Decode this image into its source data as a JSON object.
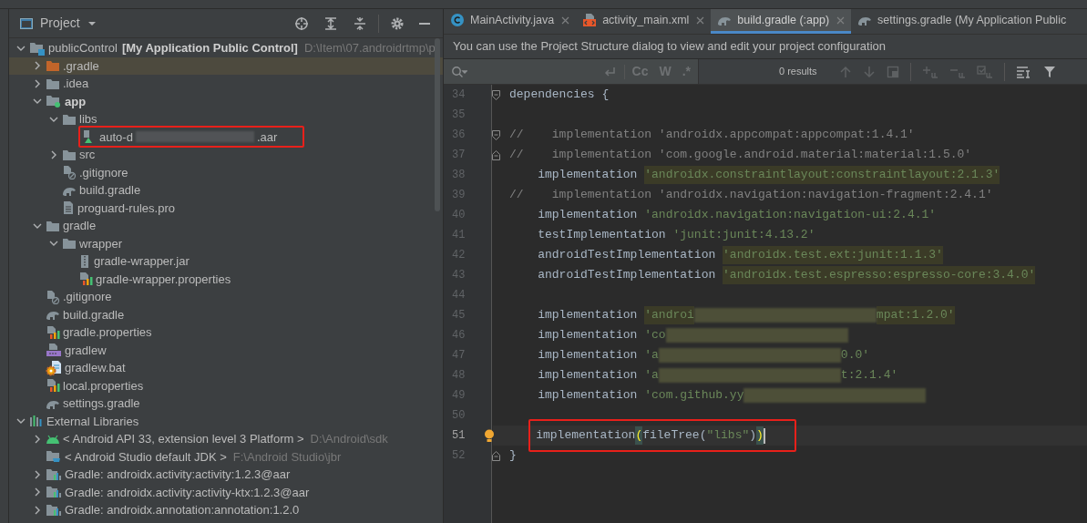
{
  "project_panel": {
    "title": "Project",
    "tree": [
      {
        "name": "publicControl",
        "module": "[My Application Public Control]",
        "path": "D:\\Item\\07.androidrtmp\\p",
        "kind": "module",
        "expanded": true,
        "selected": false,
        "children": [
          {
            "name": ".gradle",
            "kind": "folder-orange",
            "expanded": false,
            "selected": true
          },
          {
            "name": ".idea",
            "kind": "folder",
            "expanded": false,
            "selected": false
          },
          {
            "name": "app",
            "kind": "module-app",
            "expanded": true,
            "selected": false,
            "bold": true,
            "children": [
              {
                "name": "libs",
                "kind": "folder",
                "expanded": true,
                "selected": false,
                "children": [
                  {
                    "name": "auto-d",
                    "suffix": ".aar",
                    "redacted": true,
                    "kind": "aar",
                    "selected": false,
                    "annotated": true
                  }
                ]
              },
              {
                "name": "src",
                "kind": "folder",
                "expanded": false,
                "selected": false
              },
              {
                "name": ".gitignore",
                "kind": "gitignore",
                "selected": false
              },
              {
                "name": "build.gradle",
                "kind": "gradle",
                "selected": false
              },
              {
                "name": "proguard-rules.pro",
                "kind": "text",
                "selected": false
              }
            ]
          },
          {
            "name": "gradle",
            "kind": "folder",
            "expanded": true,
            "selected": false,
            "children": [
              {
                "name": "wrapper",
                "kind": "folder",
                "expanded": true,
                "selected": false,
                "children": [
                  {
                    "name": "gradle-wrapper.jar",
                    "kind": "jar",
                    "selected": false
                  },
                  {
                    "name": "gradle-wrapper.properties",
                    "kind": "properties",
                    "selected": false
                  }
                ]
              }
            ]
          },
          {
            "name": ".gitignore",
            "kind": "gitignore",
            "selected": false
          },
          {
            "name": "build.gradle",
            "kind": "gradle",
            "selected": false
          },
          {
            "name": "gradle.properties",
            "kind": "properties",
            "selected": false
          },
          {
            "name": "gradlew",
            "kind": "shell",
            "selected": false
          },
          {
            "name": "gradlew.bat",
            "kind": "bat",
            "selected": false
          },
          {
            "name": "local.properties",
            "kind": "properties",
            "selected": false
          },
          {
            "name": "settings.gradle",
            "kind": "gradle",
            "selected": false
          }
        ]
      },
      {
        "name": "External Libraries",
        "kind": "libraries",
        "expanded": true,
        "selected": false,
        "children": [
          {
            "name": "< Android API 33, extension level 3 Platform >",
            "path": "D:\\Android\\sdk",
            "kind": "android",
            "expanded": false,
            "selected": false
          },
          {
            "name": "< Android Studio default JDK >",
            "path": "F:\\Android Studio\\jbr",
            "kind": "jdk",
            "selected": false
          },
          {
            "name": "Gradle: androidx.activity:activity:1.2.3@aar",
            "kind": "library",
            "expanded": false,
            "selected": false
          },
          {
            "name": "Gradle: androidx.activity:activity-ktx:1.2.3@aar",
            "kind": "library",
            "expanded": false,
            "selected": false
          },
          {
            "name": "Gradle: androidx.annotation:annotation:1.2.0",
            "kind": "library",
            "expanded": false,
            "selected": false
          }
        ]
      }
    ]
  },
  "editor": {
    "tabs": [
      {
        "label": "MainActivity.java",
        "kind": "class",
        "closable": true,
        "selected": false
      },
      {
        "label": "activity_main.xml",
        "kind": "xml",
        "closable": true,
        "selected": false
      },
      {
        "label": "build.gradle (:app)",
        "kind": "gradle",
        "closable": true,
        "selected": true
      },
      {
        "label": "settings.gradle (My Application Public",
        "kind": "gradle",
        "closable": false,
        "selected": false
      }
    ],
    "banner": "You can use the Project Structure dialog to view and edit your project configuration",
    "search": {
      "toggles": [
        "Cc",
        "W",
        ".*"
      ],
      "results": "0 results"
    },
    "lines": [
      {
        "number": "34",
        "fold_start": true,
        "tokens": [
          {
            "kind": "code",
            "text": "dependencies {"
          }
        ]
      },
      {
        "number": "35"
      },
      {
        "number": "36",
        "fold_start": true,
        "tokens": [
          {
            "kind": "comment",
            "text": "//    implementation 'androidx.appcompat:appcompat:1.4.1'"
          }
        ]
      },
      {
        "number": "37",
        "fold_end": true,
        "tokens": [
          {
            "kind": "comment",
            "text": "//    implementation 'com.google.android.material:material:1.5.0'"
          }
        ]
      },
      {
        "number": "38",
        "tokens": [
          {
            "kind": "code",
            "text": "    implementation "
          },
          {
            "kind": "string_hl",
            "text": "'androidx.constraintlayout:constraintlayout:2.1.3'"
          }
        ]
      },
      {
        "number": "39",
        "tokens": [
          {
            "kind": "comment",
            "text": "//    implementation 'androidx.navigation:navigation-fragment:2.4.1'"
          }
        ]
      },
      {
        "number": "40",
        "tokens": [
          {
            "kind": "code",
            "text": "    implementation "
          },
          {
            "kind": "string",
            "text": "'androidx.navigation:navigation-ui:2.4.1'"
          }
        ]
      },
      {
        "number": "41",
        "tokens": [
          {
            "kind": "code",
            "text": "    testImplementation "
          },
          {
            "kind": "string",
            "text": "'junit:junit:4.13.2'"
          }
        ]
      },
      {
        "number": "42",
        "tokens": [
          {
            "kind": "code",
            "text": "    androidTestImplementation "
          },
          {
            "kind": "string_hl",
            "text": "'androidx.test.ext:junit:1.1.3'"
          }
        ]
      },
      {
        "number": "43",
        "tokens": [
          {
            "kind": "code",
            "text": "    androidTestImplementation "
          },
          {
            "kind": "string_hl",
            "text": "'androidx.test.espresso:espresso-core:3.4.0'"
          }
        ]
      },
      {
        "number": "44"
      },
      {
        "number": "45",
        "tokens": [
          {
            "kind": "code",
            "text": "    implementation "
          },
          {
            "kind": "string_hl",
            "text": "'androi"
          },
          {
            "kind": "redacted"
          },
          {
            "kind": "string_hl",
            "text": "mpat:1.2.0'"
          }
        ]
      },
      {
        "number": "46",
        "tokens": [
          {
            "kind": "code",
            "text": "    implementation "
          },
          {
            "kind": "string",
            "text": "'co"
          },
          {
            "kind": "redacted"
          }
        ]
      },
      {
        "number": "47",
        "tokens": [
          {
            "kind": "code",
            "text": "    implementation "
          },
          {
            "kind": "string",
            "text": "'a"
          },
          {
            "kind": "redacted"
          },
          {
            "kind": "string",
            "text": "0.0'"
          }
        ]
      },
      {
        "number": "48",
        "tokens": [
          {
            "kind": "code",
            "text": "    implementation "
          },
          {
            "kind": "string",
            "text": "'a"
          },
          {
            "kind": "redacted"
          },
          {
            "kind": "string",
            "text": "t:2.1.4'"
          }
        ]
      },
      {
        "number": "49",
        "tokens": [
          {
            "kind": "code",
            "text": "    implementation "
          },
          {
            "kind": "string",
            "text": "'com.github.yy"
          },
          {
            "kind": "redacted"
          }
        ]
      },
      {
        "number": "50"
      },
      {
        "number": "51",
        "current": true,
        "bulb": true,
        "annotated": true,
        "tokens": [
          {
            "kind": "code",
            "text": "    implementation"
          },
          {
            "kind": "paren_match",
            "text": "("
          },
          {
            "kind": "code",
            "text": "fileTree("
          },
          {
            "kind": "string",
            "text": "\"libs\""
          },
          {
            "kind": "code",
            "text": ")"
          },
          {
            "kind": "paren_match",
            "text": ")"
          }
        ]
      },
      {
        "number": "52",
        "fold_end": true,
        "tokens": [
          {
            "kind": "code",
            "text": "}"
          }
        ]
      }
    ]
  }
}
